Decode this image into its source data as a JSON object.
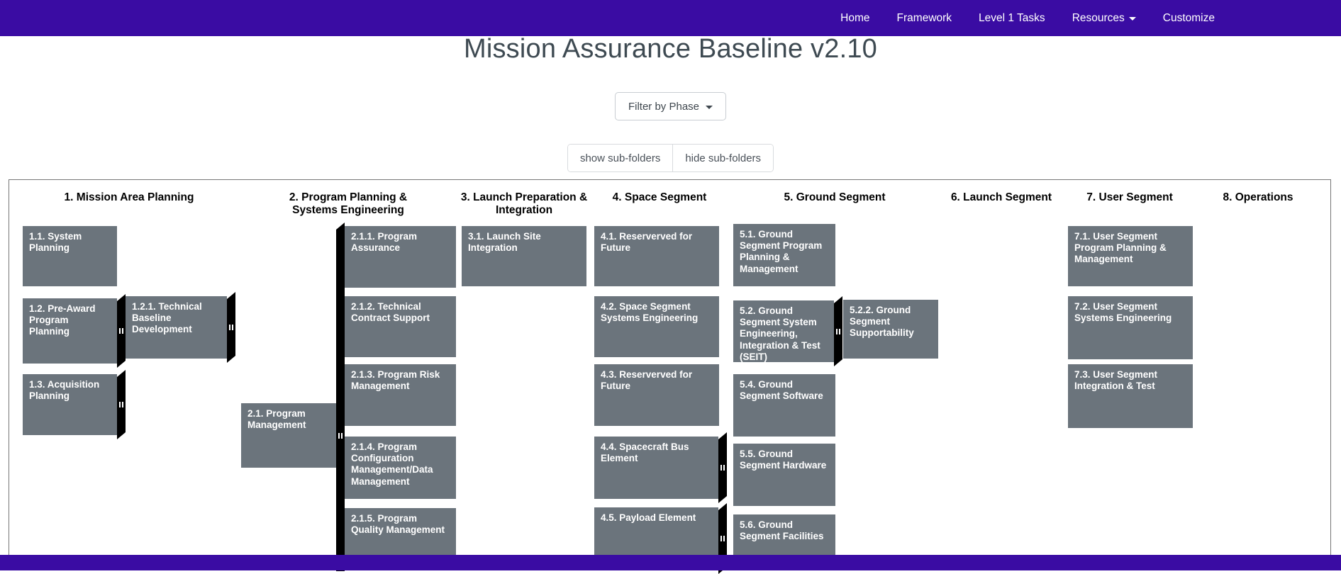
{
  "navbar": {
    "items": [
      {
        "label": "Home"
      },
      {
        "label": "Framework"
      },
      {
        "label": "Level 1 Tasks"
      },
      {
        "label": "Resources",
        "has_caret": true
      },
      {
        "label": "Customize"
      }
    ]
  },
  "page": {
    "title": "Mission Assurance Baseline v2.10"
  },
  "controls": {
    "filter_button": "Filter by Phase",
    "show_subfolders": "show sub-folders",
    "hide_subfolders": "hide sub-folders"
  },
  "board": {
    "columns": [
      {
        "header": "1. Mission Area Planning",
        "boxes": [
          {
            "label": "1.1. System Planning"
          },
          {
            "label": "1.2. Pre-Award Program Planning"
          },
          {
            "label": "1.2.1. Technical Baseline Development"
          },
          {
            "label": "1.3. Acquisition Planning"
          }
        ]
      },
      {
        "header": "2. Program Planning & Systems Engineering",
        "boxes": [
          {
            "label": "2.1. Program Management"
          },
          {
            "label": "2.1.1. Program Assurance"
          },
          {
            "label": "2.1.2. Technical Contract Support"
          },
          {
            "label": "2.1.3. Program Risk Management"
          },
          {
            "label": "2.1.4. Program Configuration Management/Data Management"
          },
          {
            "label": "2.1.5. Program Quality Management"
          }
        ]
      },
      {
        "header": "3. Launch Preparation & Integration",
        "boxes": [
          {
            "label": "3.1. Launch Site Integration"
          }
        ]
      },
      {
        "header": "4. Space Segment",
        "boxes": [
          {
            "label": "4.1. Reserverved for Future"
          },
          {
            "label": "4.2. Space Segment Systems Engineering"
          },
          {
            "label": "4.3. Reserverved for Future"
          },
          {
            "label": "4.4. Spacecraft Bus Element"
          },
          {
            "label": "4.5. Payload Element"
          }
        ]
      },
      {
        "header": "5. Ground Segment",
        "boxes": [
          {
            "label": "5.1. Ground Segment Program Planning & Management"
          },
          {
            "label": "5.2. Ground Segment System Engineering, Integration & Test (SEIT)"
          },
          {
            "label": "5.2.2. Ground Segment Supportability"
          },
          {
            "label": "5.4. Ground Segment Software"
          },
          {
            "label": "5.5. Ground Segment Hardware"
          },
          {
            "label": "5.6. Ground Segment Facilities"
          }
        ]
      },
      {
        "header": "6. Launch Segment",
        "boxes": []
      },
      {
        "header": "7. User Segment",
        "boxes": [
          {
            "label": "7.1. User Segment Program Planning & Management"
          },
          {
            "label": "7.2. User Segment Systems Engineering"
          },
          {
            "label": "7.3. User Segment Integration & Test"
          }
        ]
      },
      {
        "header": "8. Operations",
        "boxes": []
      }
    ]
  },
  "colors": {
    "accent_purple": "#3a0ca3",
    "box_gray": "#6b747c",
    "handle_black": "#000000",
    "title_text": "#3e4a52"
  }
}
